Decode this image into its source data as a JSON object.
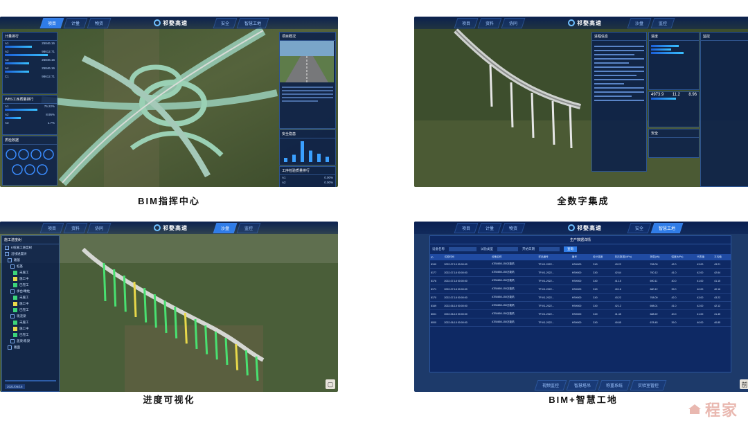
{
  "brand": {
    "name": "祁婺高速"
  },
  "panels": [
    {
      "caption": "BIM指挥中心",
      "tabs_left": [
        "项目",
        "计量",
        "物资"
      ],
      "tabs_right": [
        "安全",
        "智慧工地"
      ],
      "active": 0
    },
    {
      "caption": "全数字集成",
      "tabs_left": [
        "项目",
        "资料",
        "协同"
      ],
      "tabs_right": [
        "沙盘",
        "监控"
      ],
      "active": 0
    },
    {
      "caption": "进度可视化",
      "tabs_left": [
        "项目",
        "资料",
        "协同"
      ],
      "tabs_right": [
        "沙盘",
        "监控"
      ],
      "active": 3
    },
    {
      "caption": "BIM+智慧工地",
      "tabs_left": [
        "项目",
        "计量",
        "物资"
      ],
      "tabs_right": [
        "安全",
        "智慧工地"
      ],
      "active": 4
    }
  ],
  "p1": {
    "left1": {
      "title": "计量排行",
      "rows": [
        [
          "A1",
          "25846.16"
        ],
        [
          "A2",
          "98612.71"
        ],
        [
          "A3",
          "25846.16"
        ],
        [
          "A4",
          "25846.16"
        ],
        [
          "C1",
          "98612.71"
        ]
      ]
    },
    "left2": {
      "title": "WBS工序质量排行",
      "rows": [
        [
          "A1",
          "76.22%"
        ],
        [
          "A2",
          "8.95%"
        ],
        [
          "A3",
          "1.7%"
        ]
      ]
    },
    "left3": {
      "title": "质检数据"
    },
    "right1": {
      "title": "项目概况"
    },
    "right2": {
      "title": "安全隐患"
    },
    "right3": {
      "title": "工序检验质量排行",
      "rows": [
        [
          "A1",
          "0.00%"
        ],
        [
          "A2",
          "0.00%"
        ],
        [
          "A3",
          "0.00%"
        ]
      ]
    },
    "bars": [
      8,
      14,
      40,
      22,
      16,
      10
    ]
  },
  "p2": {
    "list_title": "进程信息",
    "stats_title": "进度",
    "stats": [
      "4973.9",
      "11.2",
      "8.96"
    ],
    "safety_title": "安全",
    "right_title": "监控"
  },
  "p3": {
    "tree_title": "施工进度树",
    "tree": [
      "K桩施工进度树",
      "沿线进度树",
      "路基",
      "桩基",
      "未施工",
      "施工中",
      "已完工",
      "承台/墩柱",
      "未施工",
      "施工中",
      "已完工",
      "现浇梁",
      "未施工",
      "施工中",
      "已完工",
      "盖梁/系梁",
      "路面"
    ],
    "date": "2021/06/16"
  },
  "p4": {
    "table_title": "生产数据详情",
    "filters": {
      "device": "设备名称",
      "type": "试验类型",
      "date": "开始日期",
      "query": "查询"
    },
    "headers": [
      "ID",
      "试验时间",
      "设备名称",
      "样品编号",
      "编号",
      "设计强度",
      "抗压数据(MPa)",
      "荷载(kN)",
      "强度(MPa)",
      "代表值",
      "平均值"
    ],
    "rows": [
      [
        "8190",
        "2022-07-19 00:00:00",
        "ATB0850-150万能机",
        "TP-K1-2022…",
        "HSH000",
        "C40",
        "43.22",
        "708.09",
        "42.0",
        "43.00",
        "43.21"
      ],
      [
        "8177",
        "2022-07-18 00:00:00",
        "ATB0850-150万能机",
        "TP-K1-2022…",
        "HSH000",
        "C40",
        "42.64",
        "700.12",
        "41.0",
        "42.00",
        "42.64"
      ],
      [
        "8176",
        "2022-07-18 00:00:00",
        "ATB0850-150万能机",
        "TP-K1-2022…",
        "HSH000",
        "C40",
        "41.15",
        "690.11",
        "40.0",
        "41.00",
        "41.15"
      ],
      [
        "8171",
        "2022-07-18 00:00:00",
        "ATB0850-150万能机",
        "TP-K1-2022…",
        "HSH000",
        "C40",
        "40.16",
        "680.12",
        "39.0",
        "40.00",
        "40.16"
      ],
      [
        "8170",
        "2022-07-18 00:00:00",
        "ATB0850-150万能机",
        "TP-K1-2022…",
        "HSH000",
        "C40",
        "43.22",
        "708.09",
        "42.0",
        "43.00",
        "43.22"
      ],
      [
        "8169",
        "2022-06-15 00:00:00",
        "ATB0850-150万能机",
        "TP-K1-2022…",
        "HSH000",
        "C40",
        "42.12",
        "698.01",
        "41.0",
        "42.00",
        "42.12"
      ],
      [
        "8001",
        "2022-06-15 00:00:00",
        "ATB0850-150万能机",
        "TP-K1-2022…",
        "HSH000",
        "C40",
        "41.45",
        "688.22",
        "40.0",
        "41.00",
        "41.45"
      ],
      [
        "8000",
        "2022-06-15 00:00:00",
        "ATB0850-150万能机",
        "TP-K1-2022…",
        "HSH000",
        "C40",
        "40.85",
        "678.45",
        "39.0",
        "40.00",
        "40.85"
      ]
    ],
    "footer_tabs": [
      "视频监控",
      "智慧塔吊",
      "称重系统",
      "实验室管控"
    ]
  },
  "watermark": "程家"
}
